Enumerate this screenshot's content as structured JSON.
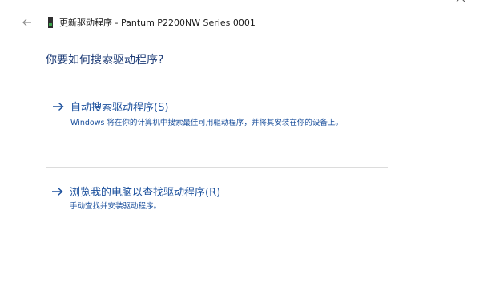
{
  "window": {
    "title": "更新驱动程序 - Pantum P2200NW Series 0001"
  },
  "icons": {
    "back": "back-arrow-icon",
    "device": "printer-device-icon",
    "close": "close-icon",
    "option_arrow": "right-arrow-icon"
  },
  "main": {
    "question": "你要如何搜索驱动程序?",
    "options": [
      {
        "title": "自动搜索驱动程序(S)",
        "description": "Windows 将在你的计算机中搜索最佳可用驱动程序，并将其安装在你的设备上。"
      },
      {
        "title": "浏览我的电脑以查找驱动程序(R)",
        "description": "手动查找并安装驱动程序。"
      }
    ]
  },
  "colors": {
    "link": "#1a4f9c",
    "heading": "#1f3d77",
    "border": "#dcdcdc",
    "background": "#ffffff"
  }
}
